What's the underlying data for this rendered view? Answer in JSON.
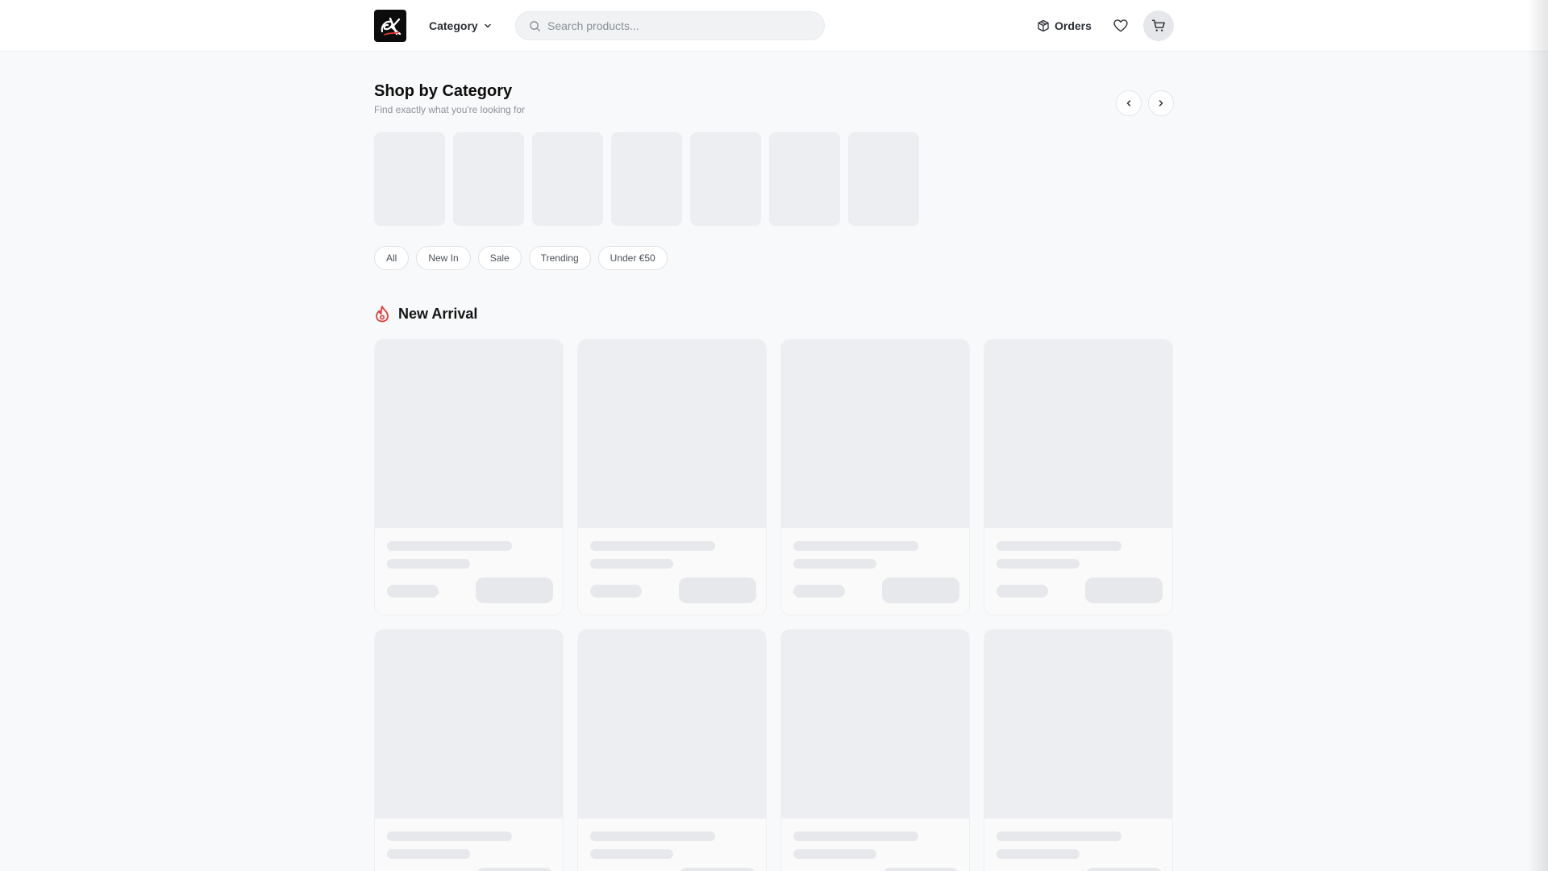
{
  "header": {
    "logo_alt": "ZK",
    "category_label": "Category",
    "search_placeholder": "Search products...",
    "orders_label": "Orders",
    "icons": [
      "search-icon",
      "chevron-down-icon",
      "package-icon",
      "heart-icon",
      "cart-icon"
    ]
  },
  "categories": {
    "title": "Shop by Category",
    "subtitle": "Find exactly what you're looking for",
    "tile_count": 7,
    "prev_icon": "chevron-left-icon",
    "next_icon": "chevron-right-icon"
  },
  "filters": [
    "All",
    "New In",
    "Sale",
    "Trending",
    "Under €50"
  ],
  "new_arrival": {
    "title": "New Arrival",
    "icon": "flame-icon",
    "accent_color": "#e53935",
    "card_count": 8
  },
  "colors": {
    "page_bg": "#f8f9fa",
    "skeleton": "#eceef1",
    "logo_bg": "#0c0c0c"
  }
}
